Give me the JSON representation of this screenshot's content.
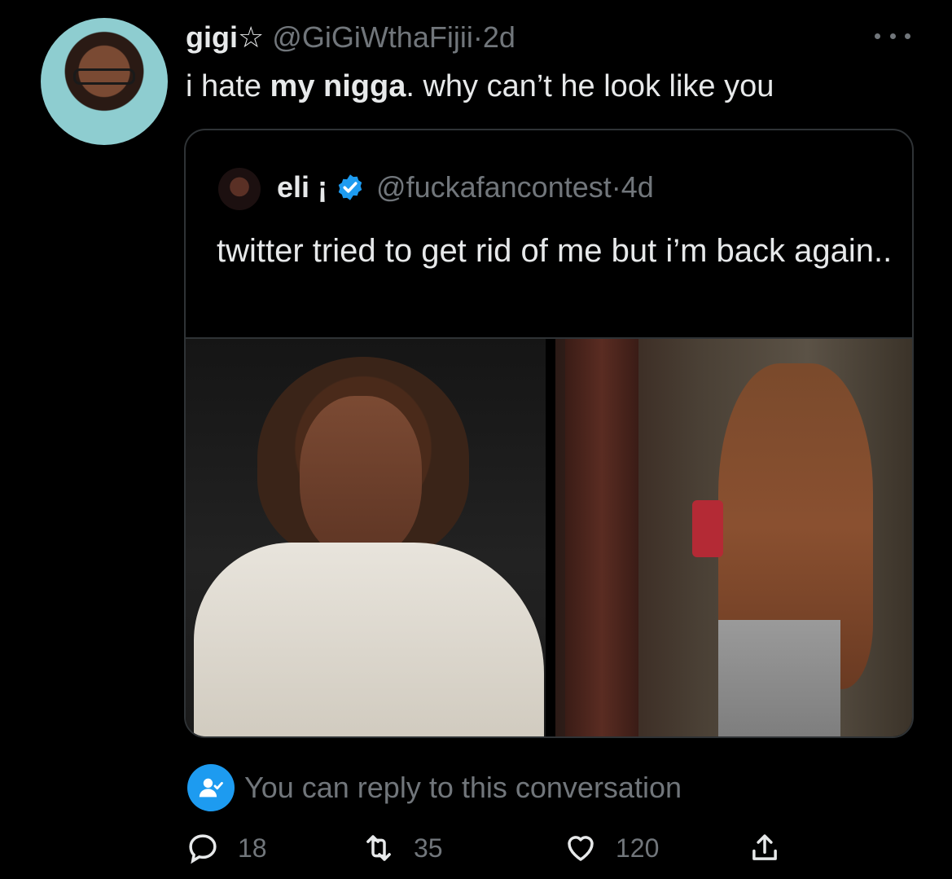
{
  "tweet": {
    "display_name": "gigi",
    "name_symbol": "☆",
    "handle": "@GiGiWthaFijii",
    "separator": "·",
    "time": "2d",
    "text_before": "i hate ",
    "text_bold": "my nigga",
    "text_after": ". why can’t he look like you"
  },
  "quoted_tweet": {
    "display_name": "eli",
    "name_symbol": "¡",
    "handle": "@fuckafancontest",
    "separator": "·",
    "time": "4d",
    "text": "twitter tried to get rid of me but i’m back again..",
    "verified_color": "#1d9bf0"
  },
  "reply_notice": {
    "text": "You can reply to this conversation"
  },
  "actions": {
    "replies": "18",
    "retweets": "35",
    "likes": "120"
  },
  "icons": {
    "more": "more-icon",
    "reply": "reply-icon",
    "retweet": "retweet-icon",
    "like": "heart-icon",
    "share": "share-icon",
    "verified": "verified-badge-icon",
    "reply_permission": "person-check-icon"
  }
}
